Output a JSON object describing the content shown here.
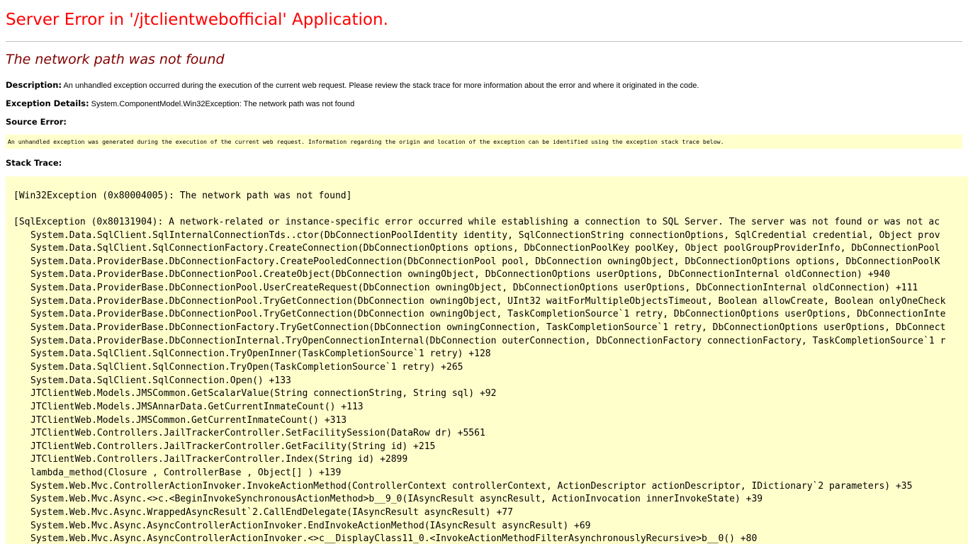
{
  "page": {
    "title": "Server Error in '/jtclientwebofficial' Application.",
    "subtitle": "The network path was not found"
  },
  "description": {
    "label": "Description:",
    "text": "An unhandled exception occurred during the execution of the current web request. Please review the stack trace for more information about the error and where it originated in the code."
  },
  "exception_details": {
    "label": "Exception Details:",
    "text": "System.ComponentModel.Win32Exception: The network path was not found"
  },
  "source_error": {
    "label": "Source Error:",
    "text": "An unhandled exception was generated during the execution of the current web request. Information regarding the origin and location of the exception can be identified using the exception stack trace below."
  },
  "stack_trace": {
    "label": "Stack Trace:",
    "win32_exception": "[Win32Exception (0x80004005): The network path was not found]",
    "sql_exception": "[SqlException (0x80131904): A network-related or instance-specific error occurred while establishing a connection to SQL Server. The server was not found or was not ac",
    "frames": [
      "System.Data.SqlClient.SqlInternalConnectionTds..ctor(DbConnectionPoolIdentity identity, SqlConnectionString connectionOptions, SqlCredential credential, Object prov",
      "System.Data.SqlClient.SqlConnectionFactory.CreateConnection(DbConnectionOptions options, DbConnectionPoolKey poolKey, Object poolGroupProviderInfo, DbConnectionPool",
      "System.Data.ProviderBase.DbConnectionFactory.CreatePooledConnection(DbConnectionPool pool, DbConnection owningObject, DbConnectionOptions options, DbConnectionPoolK",
      "System.Data.ProviderBase.DbConnectionPool.CreateObject(DbConnection owningObject, DbConnectionOptions userOptions, DbConnectionInternal oldConnection) +940",
      "System.Data.ProviderBase.DbConnectionPool.UserCreateRequest(DbConnection owningObject, DbConnectionOptions userOptions, DbConnectionInternal oldConnection) +111",
      "System.Data.ProviderBase.DbConnectionPool.TryGetConnection(DbConnection owningObject, UInt32 waitForMultipleObjectsTimeout, Boolean allowCreate, Boolean onlyOneCheck",
      "System.Data.ProviderBase.DbConnectionPool.TryGetConnection(DbConnection owningObject, TaskCompletionSource`1 retry, DbConnectionOptions userOptions, DbConnectionInte",
      "System.Data.ProviderBase.DbConnectionFactory.TryGetConnection(DbConnection owningConnection, TaskCompletionSource`1 retry, DbConnectionOptions userOptions, DbConnect",
      "System.Data.ProviderBase.DbConnectionInternal.TryOpenConnectionInternal(DbConnection outerConnection, DbConnectionFactory connectionFactory, TaskCompletionSource`1 r",
      "System.Data.SqlClient.SqlConnection.TryOpenInner(TaskCompletionSource`1 retry) +128",
      "System.Data.SqlClient.SqlConnection.TryOpen(TaskCompletionSource`1 retry) +265",
      "System.Data.SqlClient.SqlConnection.Open() +133",
      "JTClientWeb.Models.JMSCommon.GetScalarValue(String connectionString, String sql) +92",
      "JTClientWeb.Models.JMSAnnarData.GetCurrentInmateCount() +113",
      "JTClientWeb.Models.JMSCommon.GetCurrentInmateCount() +313",
      "JTClientWeb.Controllers.JailTrackerController.SetFacilitySession(DataRow dr) +5561",
      "JTClientWeb.Controllers.JailTrackerController.GetFacility(String id) +215",
      "JTClientWeb.Controllers.JailTrackerController.Index(String id) +2899",
      "lambda_method(Closure , ControllerBase , Object[] ) +139",
      "System.Web.Mvc.ControllerActionInvoker.InvokeActionMethod(ControllerContext controllerContext, ActionDescriptor actionDescriptor, IDictionary`2 parameters) +35",
      "System.Web.Mvc.Async.<>c.<BeginInvokeSynchronousActionMethod>b__9_0(IAsyncResult asyncResult, ActionInvocation innerInvokeState) +39",
      "System.Web.Mvc.Async.WrappedAsyncResult`2.CallEndDelegate(IAsyncResult asyncResult) +77",
      "System.Web.Mvc.Async.AsyncControllerActionInvoker.EndInvokeActionMethod(IAsyncResult asyncResult) +69",
      "System.Web.Mvc.Async.AsyncControllerActionInvoker.<>c__DisplayClass11_0.<InvokeActionMethodFilterAsynchronouslyRecursive>b__0() +80"
    ]
  },
  "colors": {
    "title": "#ff0000",
    "subtitle": "#800000",
    "code_background": "#ffffcc"
  }
}
